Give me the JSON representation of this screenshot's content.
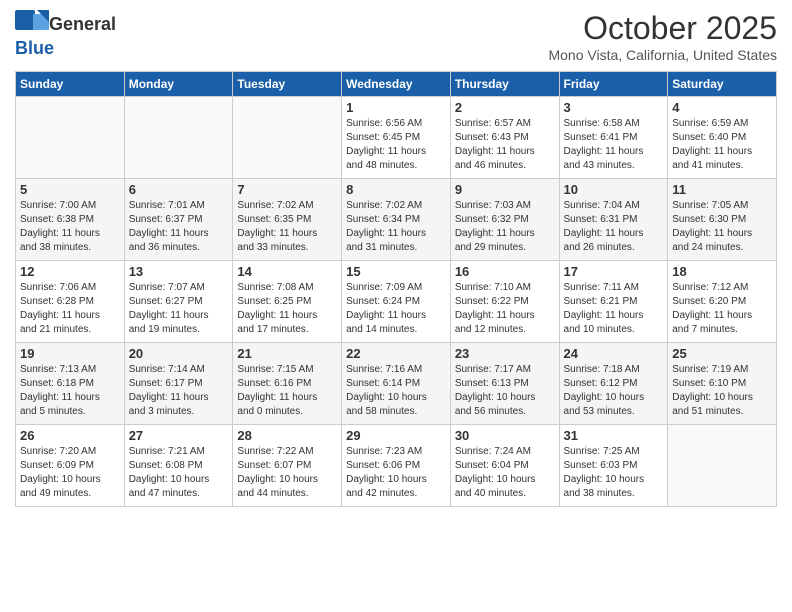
{
  "header": {
    "logo_general": "General",
    "logo_blue": "Blue",
    "title": "October 2025",
    "location": "Mono Vista, California, United States"
  },
  "weekdays": [
    "Sunday",
    "Monday",
    "Tuesday",
    "Wednesday",
    "Thursday",
    "Friday",
    "Saturday"
  ],
  "weeks": [
    [
      {
        "day": "",
        "info": ""
      },
      {
        "day": "",
        "info": ""
      },
      {
        "day": "",
        "info": ""
      },
      {
        "day": "1",
        "info": "Sunrise: 6:56 AM\nSunset: 6:45 PM\nDaylight: 11 hours\nand 48 minutes."
      },
      {
        "day": "2",
        "info": "Sunrise: 6:57 AM\nSunset: 6:43 PM\nDaylight: 11 hours\nand 46 minutes."
      },
      {
        "day": "3",
        "info": "Sunrise: 6:58 AM\nSunset: 6:41 PM\nDaylight: 11 hours\nand 43 minutes."
      },
      {
        "day": "4",
        "info": "Sunrise: 6:59 AM\nSunset: 6:40 PM\nDaylight: 11 hours\nand 41 minutes."
      }
    ],
    [
      {
        "day": "5",
        "info": "Sunrise: 7:00 AM\nSunset: 6:38 PM\nDaylight: 11 hours\nand 38 minutes."
      },
      {
        "day": "6",
        "info": "Sunrise: 7:01 AM\nSunset: 6:37 PM\nDaylight: 11 hours\nand 36 minutes."
      },
      {
        "day": "7",
        "info": "Sunrise: 7:02 AM\nSunset: 6:35 PM\nDaylight: 11 hours\nand 33 minutes."
      },
      {
        "day": "8",
        "info": "Sunrise: 7:02 AM\nSunset: 6:34 PM\nDaylight: 11 hours\nand 31 minutes."
      },
      {
        "day": "9",
        "info": "Sunrise: 7:03 AM\nSunset: 6:32 PM\nDaylight: 11 hours\nand 29 minutes."
      },
      {
        "day": "10",
        "info": "Sunrise: 7:04 AM\nSunset: 6:31 PM\nDaylight: 11 hours\nand 26 minutes."
      },
      {
        "day": "11",
        "info": "Sunrise: 7:05 AM\nSunset: 6:30 PM\nDaylight: 11 hours\nand 24 minutes."
      }
    ],
    [
      {
        "day": "12",
        "info": "Sunrise: 7:06 AM\nSunset: 6:28 PM\nDaylight: 11 hours\nand 21 minutes."
      },
      {
        "day": "13",
        "info": "Sunrise: 7:07 AM\nSunset: 6:27 PM\nDaylight: 11 hours\nand 19 minutes."
      },
      {
        "day": "14",
        "info": "Sunrise: 7:08 AM\nSunset: 6:25 PM\nDaylight: 11 hours\nand 17 minutes."
      },
      {
        "day": "15",
        "info": "Sunrise: 7:09 AM\nSunset: 6:24 PM\nDaylight: 11 hours\nand 14 minutes."
      },
      {
        "day": "16",
        "info": "Sunrise: 7:10 AM\nSunset: 6:22 PM\nDaylight: 11 hours\nand 12 minutes."
      },
      {
        "day": "17",
        "info": "Sunrise: 7:11 AM\nSunset: 6:21 PM\nDaylight: 11 hours\nand 10 minutes."
      },
      {
        "day": "18",
        "info": "Sunrise: 7:12 AM\nSunset: 6:20 PM\nDaylight: 11 hours\nand 7 minutes."
      }
    ],
    [
      {
        "day": "19",
        "info": "Sunrise: 7:13 AM\nSunset: 6:18 PM\nDaylight: 11 hours\nand 5 minutes."
      },
      {
        "day": "20",
        "info": "Sunrise: 7:14 AM\nSunset: 6:17 PM\nDaylight: 11 hours\nand 3 minutes."
      },
      {
        "day": "21",
        "info": "Sunrise: 7:15 AM\nSunset: 6:16 PM\nDaylight: 11 hours\nand 0 minutes."
      },
      {
        "day": "22",
        "info": "Sunrise: 7:16 AM\nSunset: 6:14 PM\nDaylight: 10 hours\nand 58 minutes."
      },
      {
        "day": "23",
        "info": "Sunrise: 7:17 AM\nSunset: 6:13 PM\nDaylight: 10 hours\nand 56 minutes."
      },
      {
        "day": "24",
        "info": "Sunrise: 7:18 AM\nSunset: 6:12 PM\nDaylight: 10 hours\nand 53 minutes."
      },
      {
        "day": "25",
        "info": "Sunrise: 7:19 AM\nSunset: 6:10 PM\nDaylight: 10 hours\nand 51 minutes."
      }
    ],
    [
      {
        "day": "26",
        "info": "Sunrise: 7:20 AM\nSunset: 6:09 PM\nDaylight: 10 hours\nand 49 minutes."
      },
      {
        "day": "27",
        "info": "Sunrise: 7:21 AM\nSunset: 6:08 PM\nDaylight: 10 hours\nand 47 minutes."
      },
      {
        "day": "28",
        "info": "Sunrise: 7:22 AM\nSunset: 6:07 PM\nDaylight: 10 hours\nand 44 minutes."
      },
      {
        "day": "29",
        "info": "Sunrise: 7:23 AM\nSunset: 6:06 PM\nDaylight: 10 hours\nand 42 minutes."
      },
      {
        "day": "30",
        "info": "Sunrise: 7:24 AM\nSunset: 6:04 PM\nDaylight: 10 hours\nand 40 minutes."
      },
      {
        "day": "31",
        "info": "Sunrise: 7:25 AM\nSunset: 6:03 PM\nDaylight: 10 hours\nand 38 minutes."
      },
      {
        "day": "",
        "info": ""
      }
    ]
  ]
}
